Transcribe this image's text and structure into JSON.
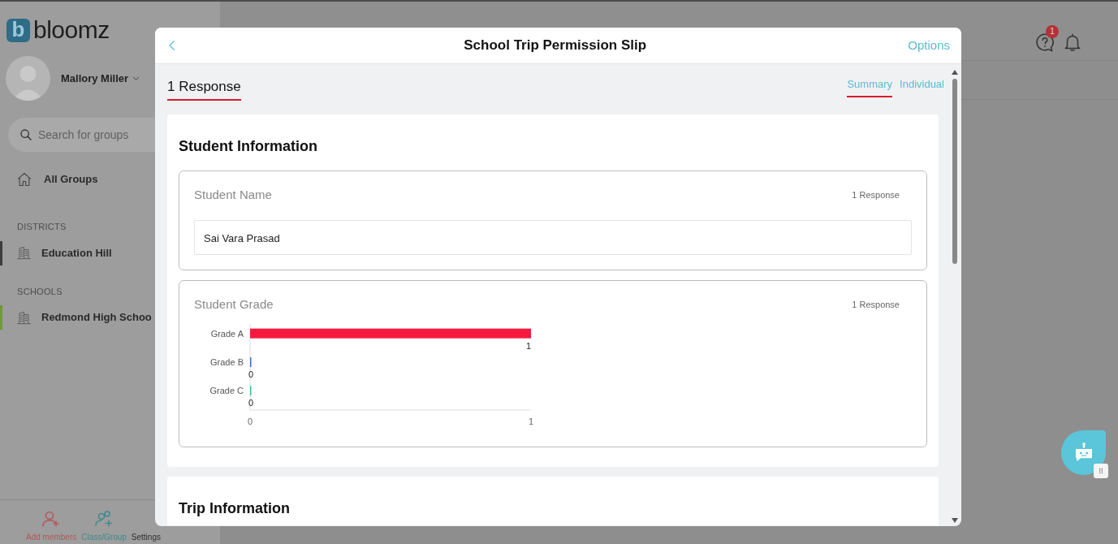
{
  "sidebar": {
    "logo_mark": "b",
    "logo_text": "bloomz",
    "user": "Mallory Miller",
    "search": {
      "placeholder": "Search for groups"
    },
    "nav": [
      {
        "label": "All Groups"
      }
    ],
    "sections": [
      {
        "heading": "DISTRICTS",
        "items": [
          {
            "label": "Education Hill",
            "color": "#3d3d3d"
          }
        ]
      },
      {
        "heading": "SCHOOLS",
        "items": [
          {
            "label": "Redmond High Schoo",
            "color": "#6f9a35"
          }
        ]
      }
    ],
    "bottom_bar": [
      {
        "kind": "add-member",
        "label": "Add members",
        "color": "#b4585a"
      },
      {
        "kind": "class-group",
        "label": "Class/Group",
        "color": "#3e8a8d"
      },
      {
        "kind": "settings",
        "label": "Settings",
        "color": "#2f2f2f"
      }
    ]
  },
  "header": {
    "help_badge": "1"
  },
  "modal": {
    "title": "School Trip Permission Slip",
    "options": "Options",
    "response_count": "1 Response",
    "tabs": [
      {
        "label": "Summary",
        "selected": true
      },
      {
        "label": "Individual",
        "selected": false
      }
    ],
    "sections": [
      {
        "title": "Student Information",
        "questions": [
          {
            "kind": "text",
            "label": "Student Name",
            "count": "1 Response",
            "answers": [
              "Sai Vara Prasad"
            ]
          },
          {
            "kind": "chart",
            "label": "Student Grade",
            "count": "1 Response",
            "chart_data": {
              "type": "bar",
              "orientation": "horizontal",
              "categories": [
                "Grade A",
                "Grade B",
                "Grade C"
              ],
              "series": [
                {
                  "color": "#f5193f",
                  "values": [
                    1,
                    null,
                    null
                  ]
                },
                {
                  "color": "#3f6fc0",
                  "values": [
                    null,
                    0,
                    null
                  ]
                },
                {
                  "color": "#3fbf9f",
                  "values": [
                    null,
                    null,
                    0
                  ]
                }
              ],
              "xlim": [
                0,
                1
              ],
              "xticks": [
                0,
                1
              ],
              "data_labels": true
            }
          }
        ]
      },
      {
        "title": "Trip Information"
      }
    ]
  }
}
